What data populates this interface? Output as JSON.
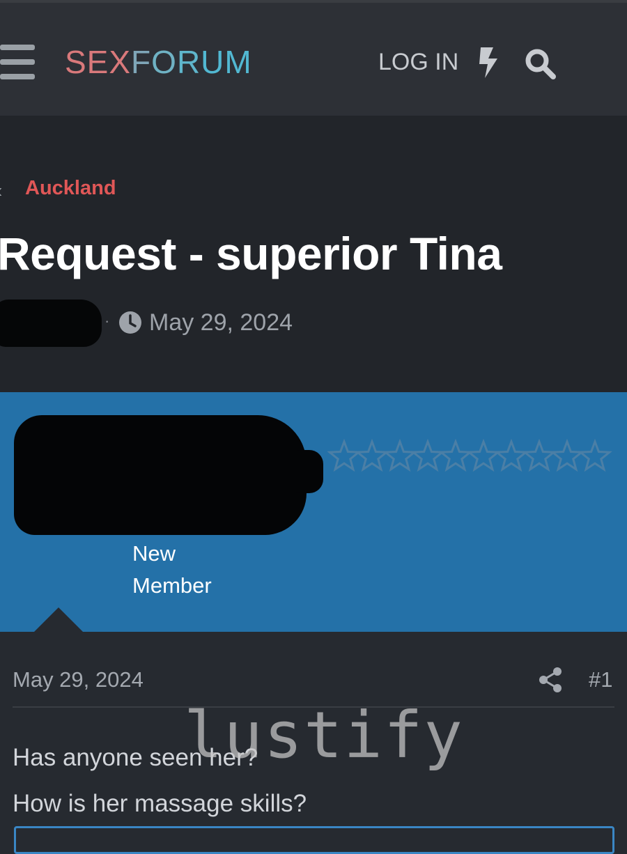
{
  "header": {
    "logo_parts": [
      "SEX",
      "F",
      "O",
      "R",
      "U",
      "M"
    ],
    "login_label": "LOG IN",
    "icons": {
      "menu": "hamburger-icon",
      "whats_new": "bolt-icon",
      "search": "search-icon"
    }
  },
  "thread": {
    "breadcrumb": "Auckland",
    "title": "Request - superior Tina",
    "separator": "·",
    "date": "May 29, 2024"
  },
  "member": {
    "role_line1": "New",
    "role_line2": "Member",
    "rating_stars": 0,
    "rating_max": 10
  },
  "post": {
    "date": "May 29, 2024",
    "number": "#1",
    "lines": [
      "Has anyone seen her?",
      "How is her massage skills?"
    ],
    "watermark": "lustify"
  },
  "colors": {
    "accent": "#e05757",
    "member_panel": "#2471a8",
    "background": "#262a30"
  }
}
